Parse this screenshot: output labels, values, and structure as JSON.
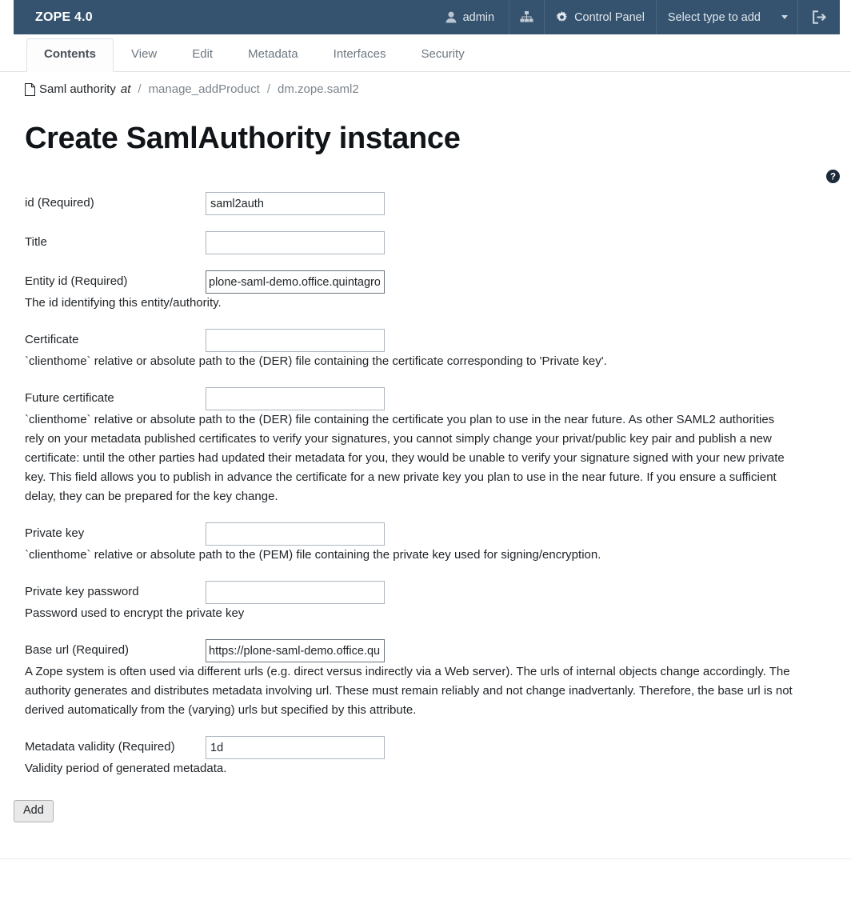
{
  "topbar": {
    "brand": "ZOPE 4.0",
    "user_icon": "user-icon",
    "user_label": "admin",
    "sitemap_icon": "sitemap-icon",
    "gear_icon": "gear-icon",
    "control_panel_label": "Control Panel",
    "add_select_label": "Select type to add",
    "caret_icon": "chevron-down-icon",
    "logout_icon": "logout-icon",
    "bg_color": "#35536f"
  },
  "tabs": [
    {
      "label": "Contents",
      "active": true
    },
    {
      "label": "View",
      "active": false
    },
    {
      "label": "Edit",
      "active": false
    },
    {
      "label": "Metadata",
      "active": false
    },
    {
      "label": "Interfaces",
      "active": false
    },
    {
      "label": "Security",
      "active": false
    }
  ],
  "breadcrumb": {
    "icon": "document-icon",
    "self": "Saml authority",
    "at": "at",
    "sep": "/",
    "items": [
      "manage_addProduct",
      "dm.zope.saml2"
    ]
  },
  "page_title": "Create SamlAuthority instance",
  "help_icon": "help-circle-icon",
  "form": {
    "fields": [
      {
        "label": "id (Required)",
        "value": "saml2auth",
        "placeholder": "",
        "help": "",
        "focused": false
      },
      {
        "label": "Title",
        "value": "",
        "placeholder": "",
        "help": "",
        "focused": false
      },
      {
        "label": "Entity id (Required)",
        "value": "plone-saml-demo.office.quintagroup.com",
        "placeholder": "",
        "help": "The id identifying this entity/authority.",
        "focused": true
      },
      {
        "label": "Certificate",
        "value": "",
        "placeholder": "",
        "help": "`clienthome` relative or absolute path to the (DER) file containing the certificate corresponding to 'Private key'.",
        "focused": false
      },
      {
        "label": "Future certificate",
        "value": "",
        "placeholder": "",
        "help": "`clienthome` relative or absolute path to the (DER) file containing the certificate you plan to use in the near future. As other SAML2 authorities rely on your metadata published certificates to verify your signatures, you cannot simply change your privat/public key pair and publish a new certificate: until the other parties had updated their metadata for you, they would be unable to verify your signature signed with your new private key. This field allows you to publish in advance the certificate for a new private key you plan to use in the near future. If you ensure a sufficient delay, they can be prepared for the key change.",
        "focused": false
      },
      {
        "label": "Private key",
        "value": "",
        "placeholder": "",
        "help": "`clienthome` relative or absolute path to the (PEM) file containing the private key used for signing/encryption.",
        "focused": false
      },
      {
        "label": "Private key password",
        "value": "",
        "placeholder": "",
        "help": "Password used to encrypt the private key",
        "focused": false
      },
      {
        "label": "Base url (Required)",
        "value": "https://plone-saml-demo.office.quintagroup.com",
        "placeholder": "",
        "help": "A Zope system is often used via different urls (e.g. direct versus indirectly via a Web server). The urls of internal objects change accordingly. The authority generates and distributes metadata involving url. These must remain reliably and not change inadvertanly. Therefore, the base url is not derived automatically from the (varying) urls but specified by this attribute.",
        "focused": true
      },
      {
        "label": "Metadata validity (Required)",
        "value": "1d",
        "placeholder": "",
        "help": "Validity period of generated metadata.",
        "focused": false
      }
    ],
    "submit_label": "Add"
  }
}
